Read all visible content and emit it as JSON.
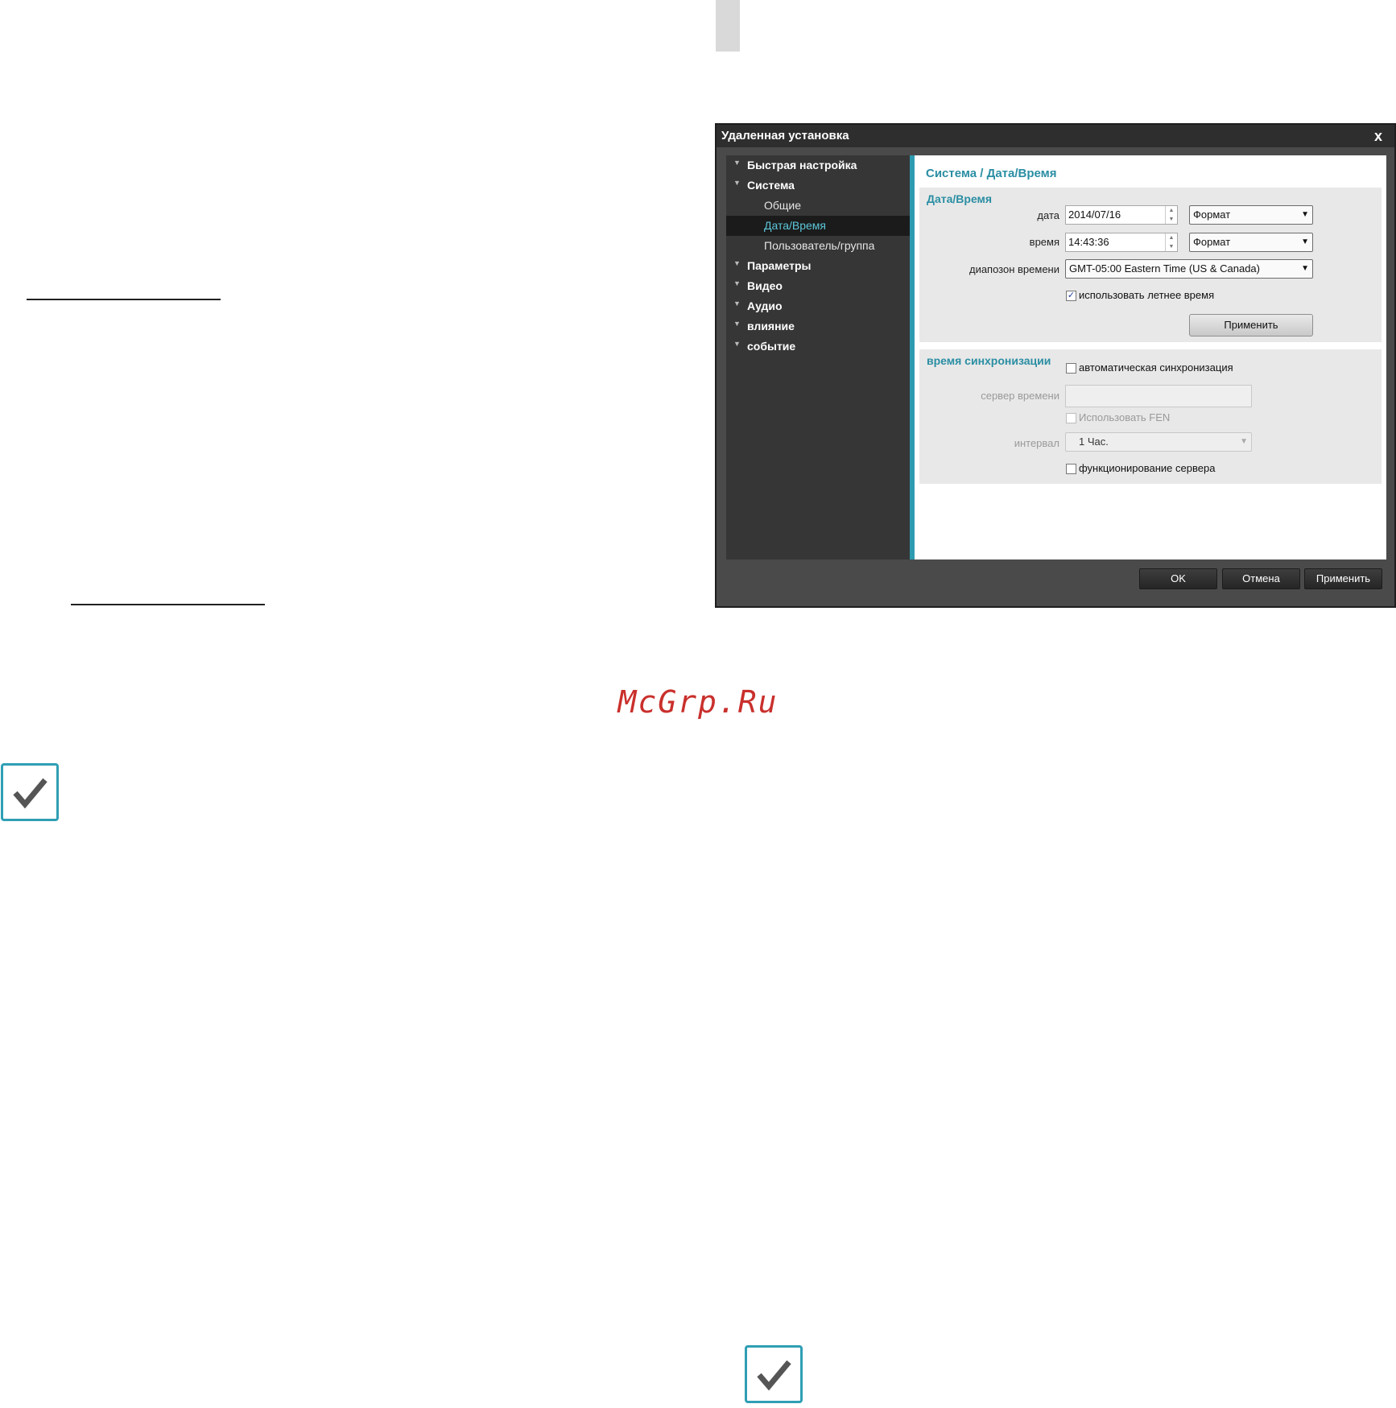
{
  "watermark": "McGrp.Ru",
  "dialog": {
    "title": "Удаленная установка",
    "close_glyph": "x",
    "tree": [
      {
        "label": "Быстрая настройка",
        "level": 0,
        "selected": false
      },
      {
        "label": "Система",
        "level": 0,
        "selected": false
      },
      {
        "label": "Общие",
        "level": 1,
        "selected": false
      },
      {
        "label": "Дата/Время",
        "level": 1,
        "selected": true
      },
      {
        "label": "Пользователь/группа",
        "level": 1,
        "selected": false
      },
      {
        "label": "Параметры",
        "level": 0,
        "selected": false
      },
      {
        "label": "Видео",
        "level": 0,
        "selected": false
      },
      {
        "label": "Аудио",
        "level": 0,
        "selected": false
      },
      {
        "label": "влияние",
        "level": 0,
        "selected": false
      },
      {
        "label": "событие",
        "level": 0,
        "selected": false
      }
    ],
    "breadcrumb": "Система / Дата/Время",
    "datetime": {
      "heading": "Дата/Время",
      "date_label": "дата",
      "date_value": "2014/07/16",
      "date_format": "Формат",
      "time_label": "время",
      "time_value": "14:43:36",
      "time_format": "Формат",
      "zone_label": "диапозон времени",
      "zone_value": "GMT-05:00 Eastern Time (US & Canada)",
      "dst_label": "использовать летнее время",
      "dst_checked": true,
      "apply_label": "Применить"
    },
    "sync": {
      "heading": "время синхронизации",
      "auto_label": "автоматическая синхронизация",
      "auto_checked": false,
      "server_label": "сервер времени",
      "server_value": "",
      "fen_label": "Использовать FEN",
      "fen_checked": false,
      "interval_label": "интервал",
      "interval_value": "1 Час.",
      "server_mode_label": "функционирование сервера",
      "server_mode_checked": false
    },
    "footer": {
      "ok": "OK",
      "cancel": "Отмена",
      "apply": "Применить"
    }
  },
  "colors": {
    "accent": "#2c9bb0",
    "watermark": "#c9302c",
    "check_icon": "#555555"
  }
}
